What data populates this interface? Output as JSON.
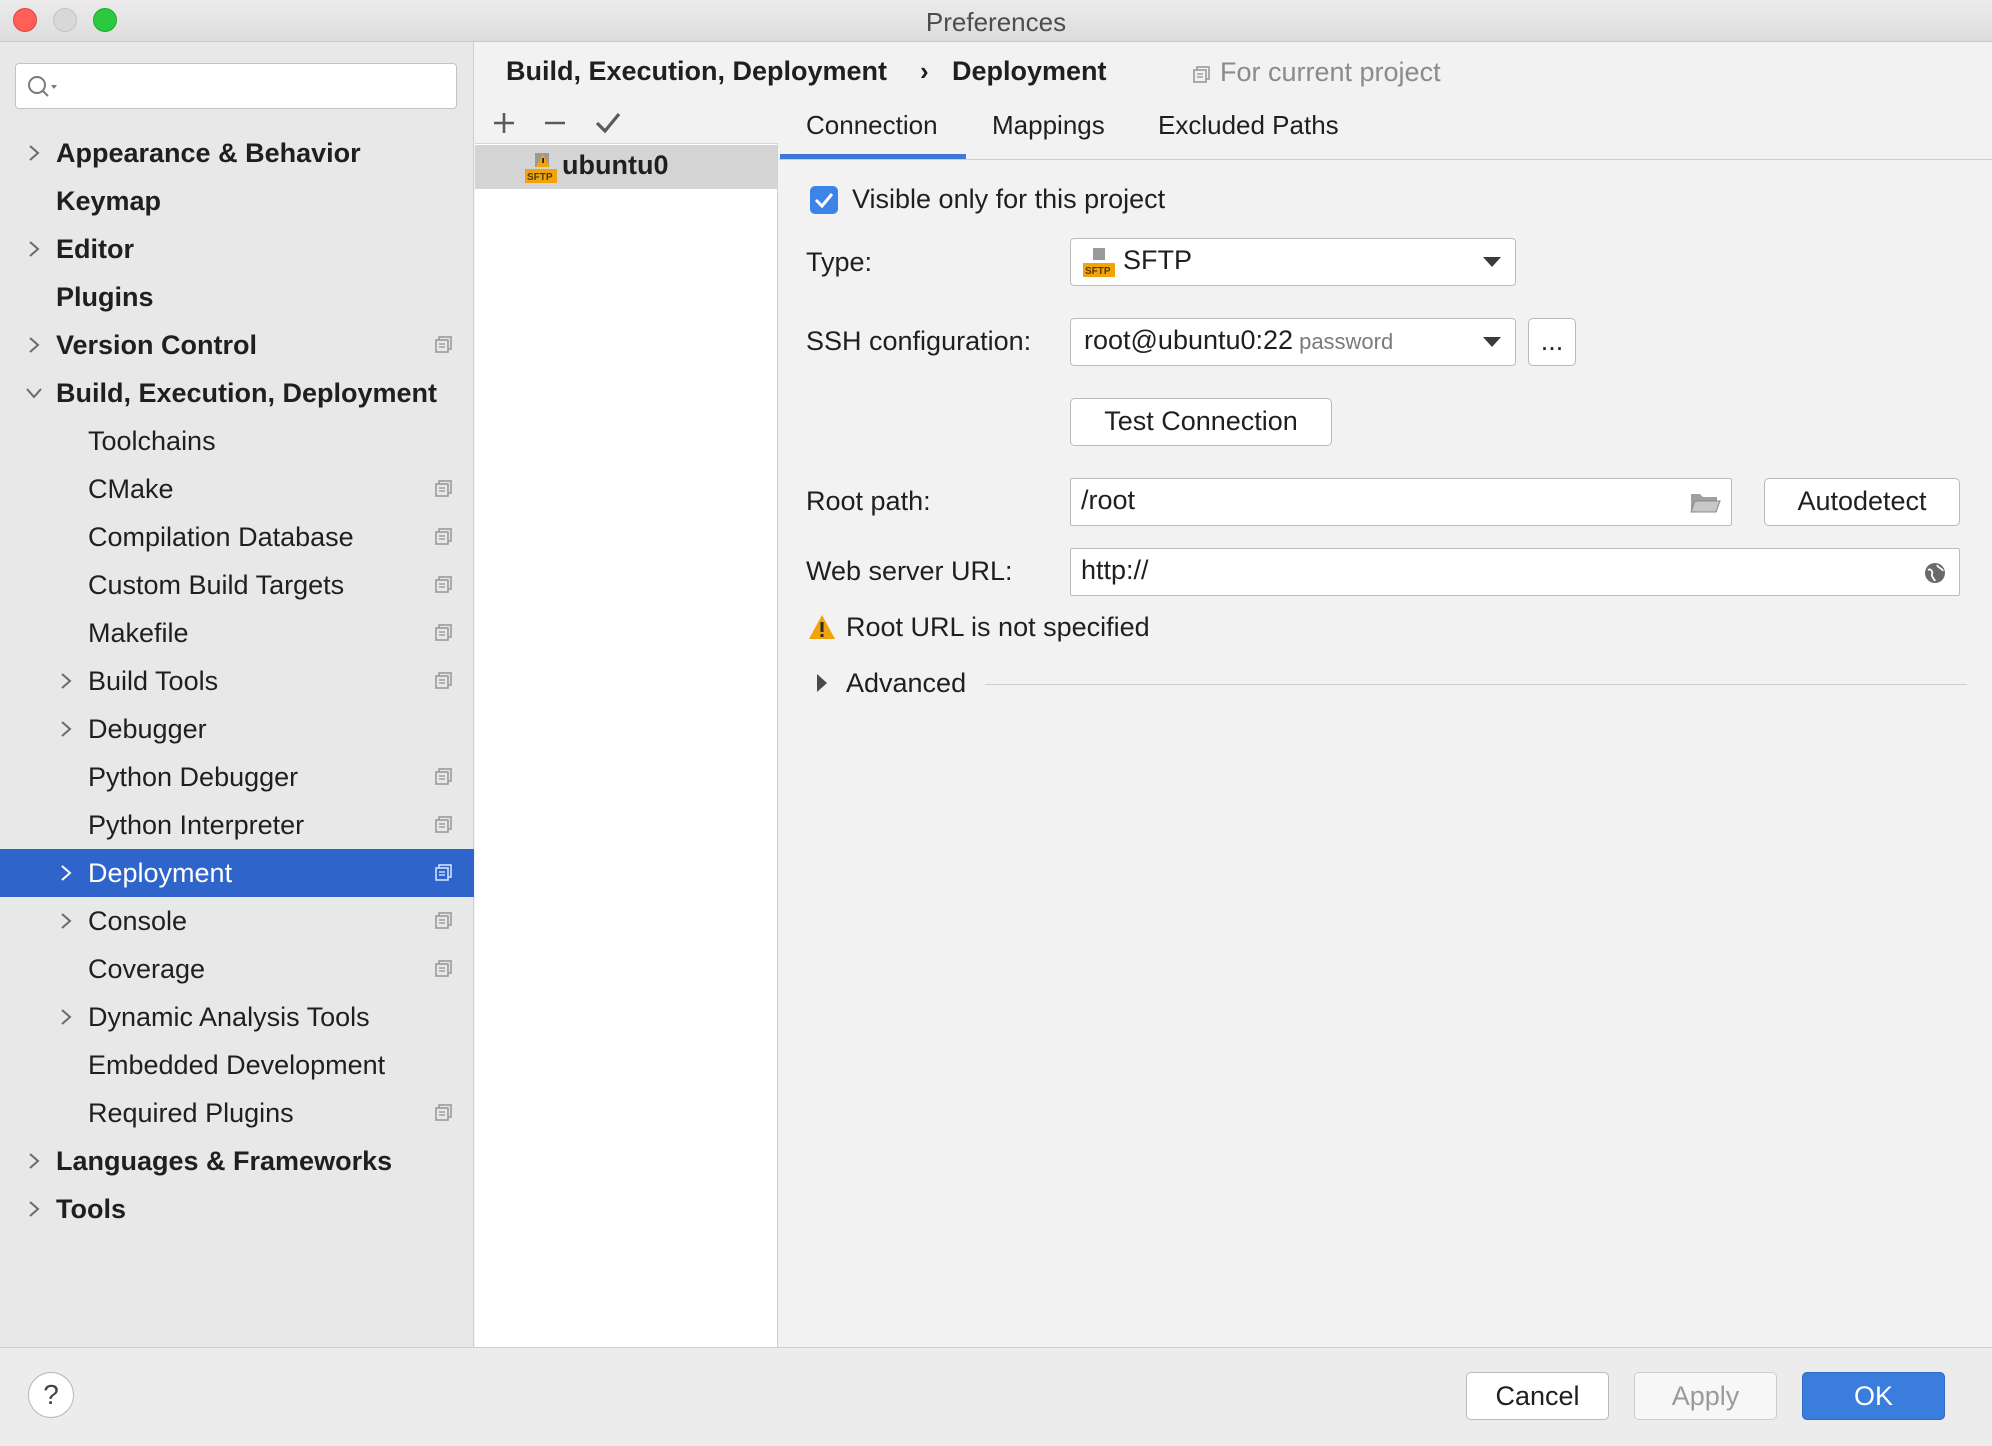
{
  "window": {
    "title": "Preferences"
  },
  "sidebar": {
    "search_placeholder": "",
    "items": [
      {
        "label": "Appearance & Behavior",
        "level": "top",
        "expandable": true
      },
      {
        "label": "Keymap",
        "level": "top",
        "expandable": false
      },
      {
        "label": "Editor",
        "level": "top",
        "expandable": true
      },
      {
        "label": "Plugins",
        "level": "top",
        "expandable": false
      },
      {
        "label": "Version Control",
        "level": "top",
        "expandable": true,
        "project": true
      },
      {
        "label": "Build, Execution, Deployment",
        "level": "top",
        "expanded": true
      },
      {
        "label": "Toolchains",
        "level": "sub"
      },
      {
        "label": "CMake",
        "level": "sub",
        "project": true
      },
      {
        "label": "Compilation Database",
        "level": "sub",
        "project": true
      },
      {
        "label": "Custom Build Targets",
        "level": "sub",
        "project": true
      },
      {
        "label": "Makefile",
        "level": "sub",
        "project": true
      },
      {
        "label": "Build Tools",
        "level": "sub",
        "expandable": true,
        "project": true
      },
      {
        "label": "Debugger",
        "level": "sub",
        "expandable": true
      },
      {
        "label": "Python Debugger",
        "level": "sub",
        "project": true
      },
      {
        "label": "Python Interpreter",
        "level": "sub",
        "project": true
      },
      {
        "label": "Deployment",
        "level": "sub",
        "expandable": true,
        "project": true,
        "selected": true
      },
      {
        "label": "Console",
        "level": "sub",
        "expandable": true,
        "project": true
      },
      {
        "label": "Coverage",
        "level": "sub",
        "project": true
      },
      {
        "label": "Dynamic Analysis Tools",
        "level": "sub",
        "expandable": true
      },
      {
        "label": "Embedded Development",
        "level": "sub"
      },
      {
        "label": "Required Plugins",
        "level": "sub",
        "project": true
      },
      {
        "label": "Languages & Frameworks",
        "level": "top",
        "expandable": true
      },
      {
        "label": "Tools",
        "level": "top",
        "expandable": true
      }
    ]
  },
  "breadcrumb": {
    "parent": "Build, Execution, Deployment",
    "separator": "›",
    "current": "Deployment",
    "scope": "For current project"
  },
  "servers": {
    "items": [
      {
        "name": "ubuntu0",
        "icon": "sftp-warning-icon"
      }
    ]
  },
  "tabs": [
    {
      "label": "Connection",
      "active": true
    },
    {
      "label": "Mappings"
    },
    {
      "label": "Excluded Paths"
    }
  ],
  "connection": {
    "visible_only_label": "Visible only for this project",
    "visible_only_checked": true,
    "type_label": "Type:",
    "type_value": "SFTP",
    "ssh_label": "SSH configuration:",
    "ssh_value": "root@ubuntu0:22",
    "ssh_hint": "password",
    "ssh_more_label": "...",
    "test_connection_label": "Test Connection",
    "root_path_label": "Root path:",
    "root_path_value": "/root",
    "autodetect_label": "Autodetect",
    "web_url_label": "Web server URL:",
    "web_url_value": "http://",
    "warning_text": "Root URL is not specified",
    "advanced_label": "Advanced"
  },
  "footer": {
    "help_label": "?",
    "cancel_label": "Cancel",
    "apply_label": "Apply",
    "ok_label": "OK"
  },
  "colors": {
    "selection": "#2f65ca",
    "primary_button": "#3b7ddd",
    "checkbox": "#3c84e8",
    "warning": "#f0a30a"
  }
}
